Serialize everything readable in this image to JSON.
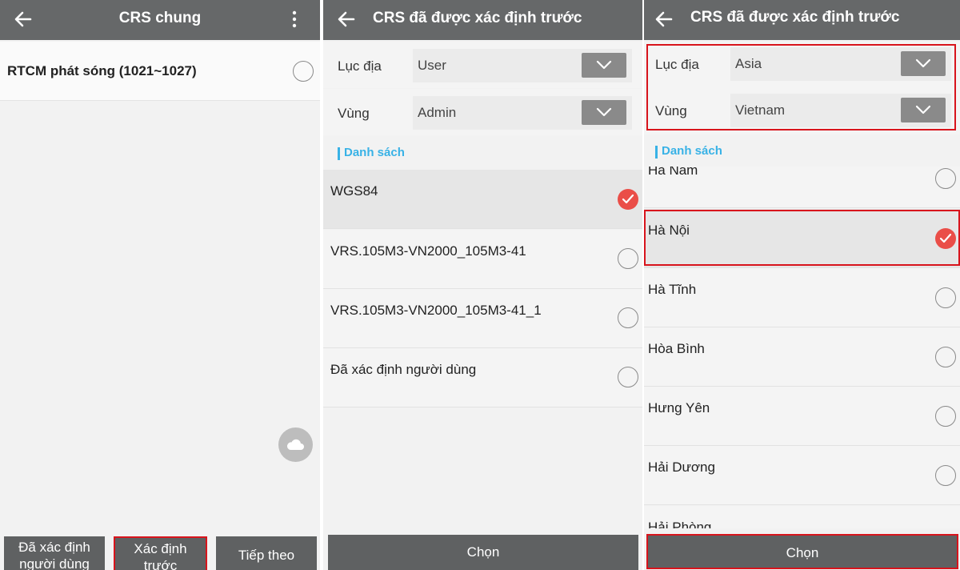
{
  "panel1": {
    "title": "CRS chung",
    "rtcm_label": "RTCM phát sóng (1021~1027)",
    "buttons": {
      "user_line1": "Đã xác định",
      "user_line2": "người dùng",
      "pre_line1": "Xác định",
      "pre_line2": "trước",
      "next": "Tiếp theo"
    }
  },
  "panel2": {
    "title": "CRS đã được xác định trước",
    "continent_label": "Lục địa",
    "continent_value": "User",
    "region_label": "Vùng",
    "region_value": "Admin",
    "section_label": "Danh sách",
    "items": [
      {
        "label": "WGS84",
        "selected": true
      },
      {
        "label": "VRS.105M3-VN2000_105M3-41",
        "selected": false
      },
      {
        "label": "VRS.105M3-VN2000_105M3-41_1",
        "selected": false
      },
      {
        "label": "Đã xác định người dùng",
        "selected": false
      }
    ],
    "choose_label": "Chọn"
  },
  "panel3": {
    "title": "CRS đã được xác định trước",
    "continent_label": "Lục địa",
    "continent_value": "Asia",
    "region_label": "Vùng",
    "region_value": "Vietnam",
    "section_label": "Danh sách",
    "items": [
      {
        "label": "Hà Nam",
        "selected": false
      },
      {
        "label": "Hà Nội",
        "selected": true
      },
      {
        "label": "Hà Tĩnh",
        "selected": false
      },
      {
        "label": "Hòa Bình",
        "selected": false
      },
      {
        "label": "Hưng Yên",
        "selected": false
      },
      {
        "label": "Hải Dương",
        "selected": false
      },
      {
        "label": "Hải Phòng",
        "selected": false
      }
    ],
    "choose_label": "Chọn"
  },
  "colors": {
    "appbar": "#666869",
    "accent_blue": "#38b2e6",
    "check_red": "#ea4e48",
    "highlight_red": "#d8141c"
  },
  "icons": [
    "back-arrow-icon",
    "more-vert-icon",
    "cloud-icon",
    "chevron-down-icon",
    "check-icon"
  ]
}
